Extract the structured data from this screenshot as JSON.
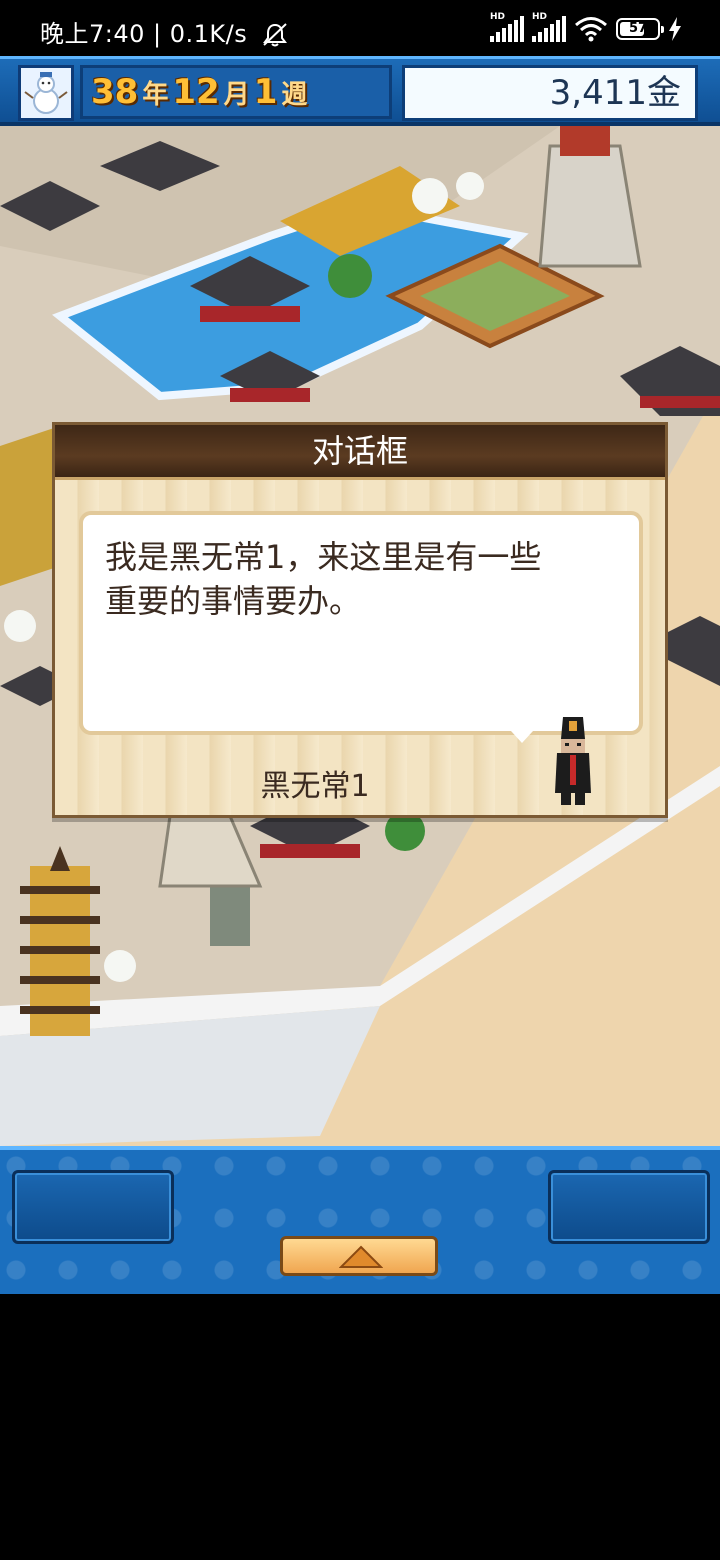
{
  "status_bar": {
    "time": "晚上7:40",
    "network_speed": "0.1K/s",
    "battery_percent": "57",
    "hd_label": "HD"
  },
  "hud": {
    "year": "38",
    "year_unit": "年",
    "month": "12",
    "month_unit": "月",
    "week": "1",
    "week_unit": "週",
    "money": "3,411金"
  },
  "dialog": {
    "title": "对话框",
    "message_line1": "我是黑无常1，来这里是有一些",
    "message_line2": "重要的事情要办。",
    "speaker": "黑无常1"
  },
  "colors": {
    "hud_blue": "#1d6cb8",
    "date_number": "#ffbf36",
    "dialog_title_bar": "#4a301b",
    "bottom_bar": "#1b6fbe"
  }
}
